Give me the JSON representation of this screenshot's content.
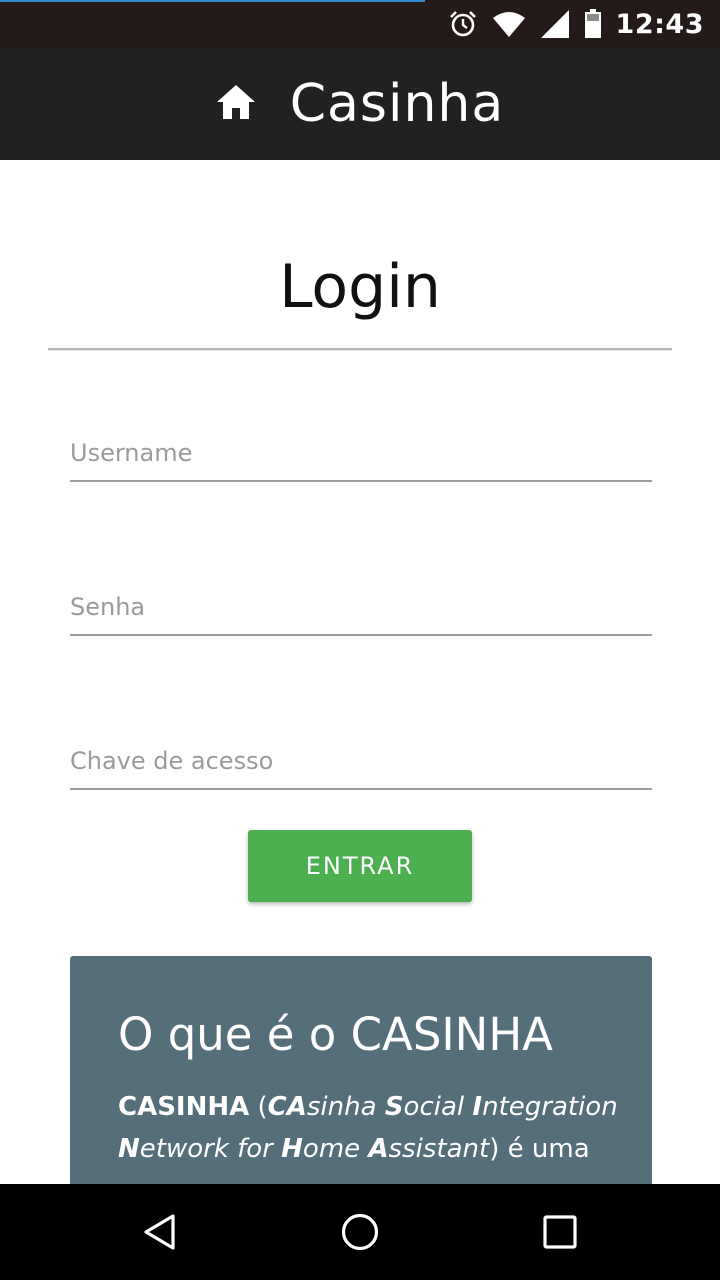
{
  "status_bar": {
    "time": "12:43",
    "icons": [
      "alarm-icon",
      "wifi-icon",
      "signal-icon",
      "battery-icon"
    ]
  },
  "app_bar": {
    "icon": "home-icon",
    "title": "Casinha"
  },
  "login": {
    "title": "Login",
    "username_placeholder": "Username",
    "password_placeholder": "Senha",
    "access_key_placeholder": "Chave de acesso",
    "submit_label": "ENTRAR"
  },
  "info_card": {
    "title": "O que é o CASINHA",
    "text_brand": "CASINHA",
    "text_paren_open": " (",
    "acr_1": "CA",
    "word_1": "sinha ",
    "acr_2": "S",
    "word_2": "ocial ",
    "acr_3": "I",
    "word_3": "ntegration ",
    "acr_4": "N",
    "word_4": "etwork for ",
    "acr_5": "H",
    "word_5": "ome ",
    "acr_6": "A",
    "word_6": "ssistant",
    "text_after": ") é uma"
  },
  "nav_bar": {
    "icons": [
      "back-icon",
      "home-circle-icon",
      "recents-icon"
    ]
  },
  "colors": {
    "status_bar": "#231a19",
    "app_bar": "#212121",
    "button": "#4caf50",
    "card": "#546e7a"
  }
}
